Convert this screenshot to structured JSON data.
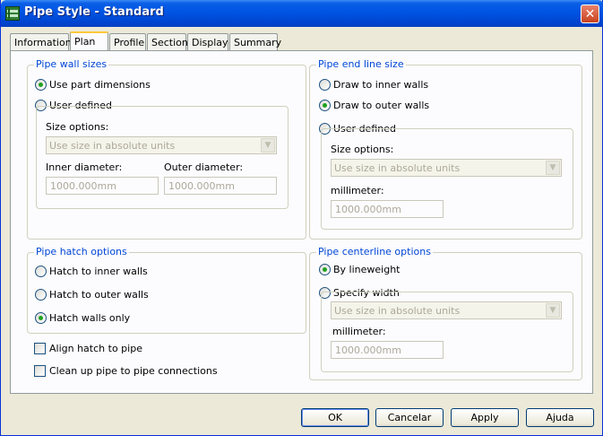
{
  "window": {
    "title": "Pipe Style - Standard",
    "app_icon": "pipe-style-icon",
    "close_icon": "close-icon",
    "close_glyph": "✕"
  },
  "tabs": [
    {
      "label": "Information",
      "active": false
    },
    {
      "label": "Plan",
      "active": true
    },
    {
      "label": "Profile",
      "active": false
    },
    {
      "label": "Section",
      "active": false
    },
    {
      "label": "Display",
      "active": false
    },
    {
      "label": "Summary",
      "active": false
    }
  ],
  "wall_sizes": {
    "legend": "Pipe wall sizes",
    "use_part_label": "Use part dimensions",
    "use_part_checked": true,
    "user_defined_label": "User defined",
    "user_defined_checked": false,
    "size_options_label": "Size options:",
    "size_options_value": "Use size in absolute units",
    "inner_label": "Inner diameter:",
    "inner_value": "1000.000mm",
    "outer_label": "Outer diameter:",
    "outer_value": "1000.000mm"
  },
  "end_line": {
    "legend": "Pipe end line size",
    "inner_label": "Draw to inner walls",
    "inner_checked": false,
    "outer_label": "Draw to outer walls",
    "outer_checked": true,
    "user_defined_label": "User defined",
    "user_defined_checked": false,
    "size_options_label": "Size options:",
    "size_options_value": "Use size in absolute units",
    "mm_label": "millimeter:",
    "mm_value": "1000.000mm"
  },
  "hatch": {
    "legend": "Pipe hatch options",
    "inner_label": "Hatch to inner walls",
    "inner_checked": false,
    "outer_label": "Hatch to outer walls",
    "outer_checked": false,
    "walls_only_label": "Hatch walls only",
    "walls_only_checked": true,
    "align_label": "Align hatch to pipe",
    "align_checked": false,
    "cleanup_label": "Clean up pipe to pipe connections",
    "cleanup_checked": false
  },
  "centerline": {
    "legend": "Pipe centerline options",
    "lineweight_label": "By lineweight",
    "lineweight_checked": true,
    "specify_label": "Specify width",
    "specify_checked": false,
    "size_options_value": "Use size in absolute units",
    "mm_label": "millimeter:",
    "mm_value": "1000.000mm"
  },
  "buttons": {
    "ok": "OK",
    "cancel": "Cancelar",
    "apply": "Apply",
    "help": "Ajuda"
  },
  "colors": {
    "title_bar": "#0054e3",
    "group_legend": "#0046d5",
    "radio_dot": "#21a121",
    "close_button": "#c9421d"
  }
}
